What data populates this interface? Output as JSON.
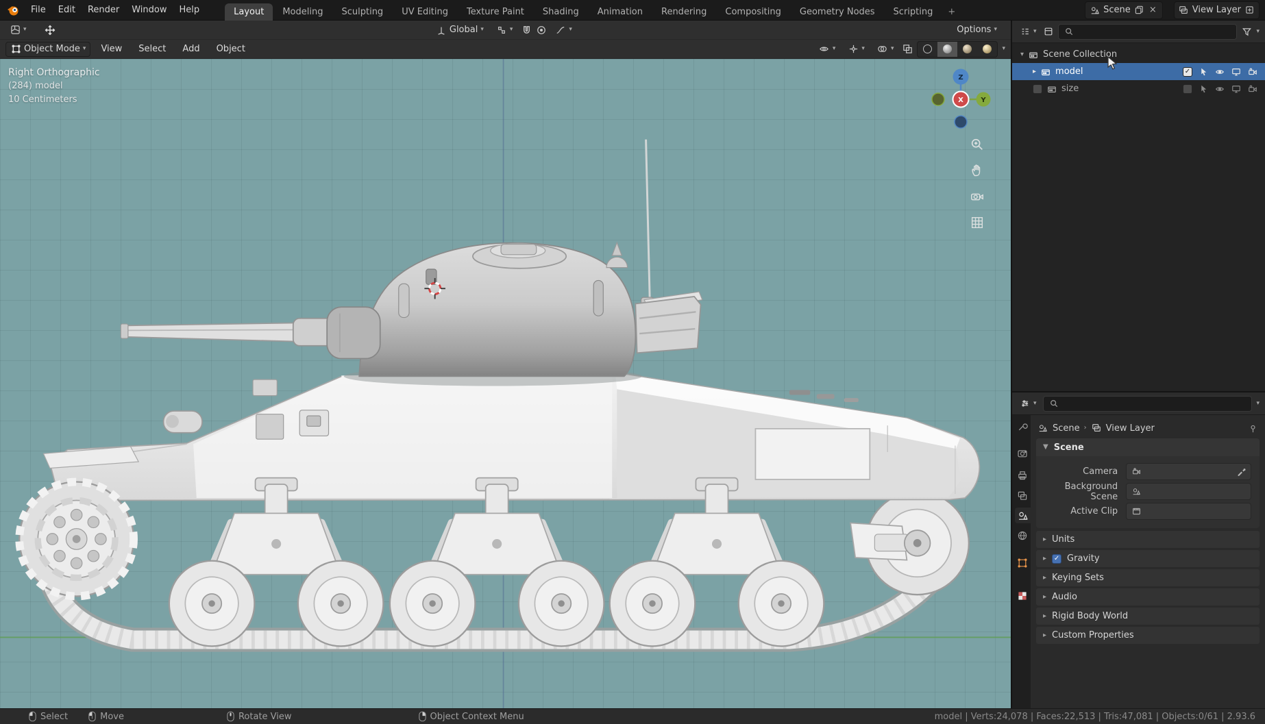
{
  "topbar": {
    "menus": [
      "File",
      "Edit",
      "Render",
      "Window",
      "Help"
    ],
    "workspaces": [
      "Layout",
      "Modeling",
      "Sculpting",
      "UV Editing",
      "Texture Paint",
      "Shading",
      "Animation",
      "Rendering",
      "Compositing",
      "Geometry Nodes",
      "Scripting"
    ],
    "new_workspace_label": "+",
    "scene_selector": {
      "label": "Scene"
    },
    "view_layer_selector": {
      "label": "View Layer"
    }
  },
  "viewport": {
    "tool_settings": {
      "orientation": "Global",
      "options_label": "Options"
    },
    "header": {
      "mode_label": "Object Mode",
      "menus": [
        "View",
        "Select",
        "Add",
        "Object"
      ]
    },
    "overlay": {
      "line1": "Right Orthographic",
      "line2": "(284) model",
      "line3": "10 Centimeters"
    },
    "axis_gizmo": {
      "x_label": "X",
      "y_label": "Y",
      "z_label": "Z"
    }
  },
  "outliner": {
    "rows": [
      {
        "label": "Scene Collection"
      },
      {
        "label": "model"
      },
      {
        "label": "size"
      }
    ]
  },
  "properties": {
    "path_bar": {
      "scene": "Scene",
      "view_layer": "View Layer"
    },
    "scene_panel_title": "Scene",
    "fields": [
      {
        "label": "Camera"
      },
      {
        "label": "Background Scene"
      },
      {
        "label": "Active Clip"
      }
    ],
    "collapsed_panels": [
      "Units",
      "Gravity",
      "Keying Sets",
      "Audio",
      "Rigid Body World",
      "Custom Properties"
    ]
  },
  "statusbar": {
    "hints": [
      "Select",
      "Move",
      "Rotate View",
      "Object Context Menu"
    ],
    "stats": "model | Verts:24,078 | Faces:22,513 | Tris:47,081 | Objects:0/61 | 2.93.6"
  },
  "colors": {
    "viewport_bg": "#7ba2a5",
    "selection": "#3d6ca6",
    "accent": "#e87d0d"
  }
}
